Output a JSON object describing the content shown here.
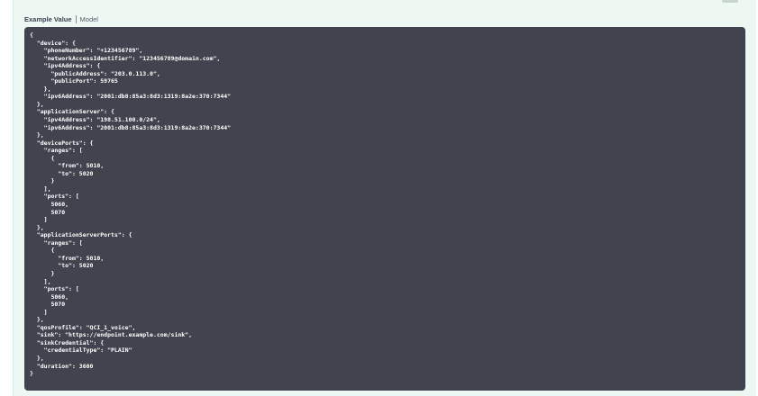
{
  "tabs": {
    "example_value": "Example Value",
    "model": "Model"
  },
  "code_lines": [
    "{",
    "  \"device\": {",
    "    \"phoneNumber\": \"+123456789\",",
    "    \"networkAccessIdentifier\": \"123456789@domain.com\",",
    "    \"ipv4Address\": {",
    "      \"publicAddress\": \"203.0.113.0\",",
    "      \"publicPort\": 59765",
    "    },",
    "    \"ipv6Address\": \"2001:db8:85a3:8d3:1319:8a2e:370:7344\"",
    "  },",
    "  \"applicationServer\": {",
    "    \"ipv4Address\": \"198.51.100.0/24\",",
    "    \"ipv6Address\": \"2001:db8:85a3:8d3:1319:8a2e:370:7344\"",
    "  },",
    "  \"devicePorts\": {",
    "    \"ranges\": [",
    "      {",
    "        \"from\": 5010,",
    "        \"to\": 5020",
    "      }",
    "    ],",
    "    \"ports\": [",
    "      5060,",
    "      5070",
    "    ]",
    "  },",
    "  \"applicationServerPorts\": {",
    "    \"ranges\": [",
    "      {",
    "        \"from\": 5010,",
    "        \"to\": 5020",
    "      }",
    "    ],",
    "    \"ports\": [",
    "      5060,",
    "      5070",
    "    ]",
    "  },",
    "  \"qosProfile\": \"QCI_1_voice\",",
    "  \"sink\": \"https://endpoint.example.com/sink\",",
    "  \"sinkCredential\": {",
    "    \"credentialType\": \"PLAIN\"",
    "  },",
    "  \"duration\": 3600",
    "}"
  ]
}
